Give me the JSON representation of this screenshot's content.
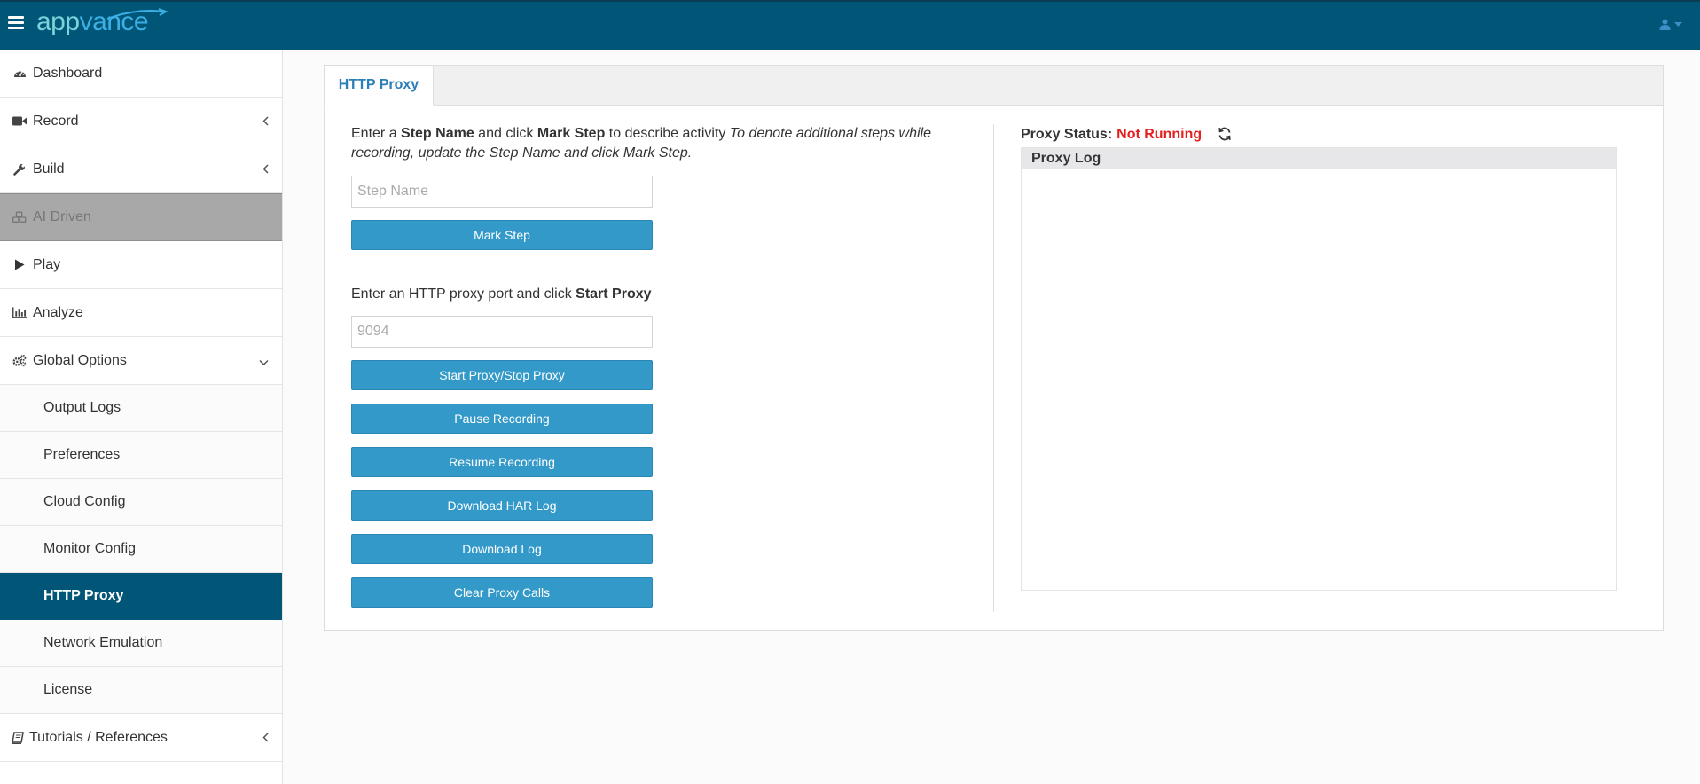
{
  "app": {
    "logo_part1": "app",
    "logo_part2": "vance"
  },
  "sidebar": {
    "items": [
      {
        "label": "Dashboard",
        "icon": "dashboard-icon"
      },
      {
        "label": "Record",
        "icon": "video-camera-icon"
      },
      {
        "label": "Build",
        "icon": "wrench-icon"
      },
      {
        "label": "AI Driven",
        "icon": "cubes-icon"
      },
      {
        "label": "Play",
        "icon": "play-icon"
      },
      {
        "label": "Analyze",
        "icon": "bar-chart-icon"
      },
      {
        "label": "Global Options",
        "icon": "gears-icon"
      }
    ],
    "sub_items": [
      "Output Logs",
      "Preferences",
      "Cloud Config",
      "Monitor Config",
      "HTTP Proxy",
      "Network Emulation",
      "License"
    ],
    "footer_item": {
      "label": "Tutorials / References",
      "icon": "book-icon"
    },
    "active_sub_item": "HTTP Proxy"
  },
  "main": {
    "tab_label": "HTTP Proxy",
    "step_instructions": {
      "t1": "Enter a ",
      "b1": "Step Name",
      "t2": " and click ",
      "b2": "Mark Step",
      "t3": " to describe activity ",
      "i1": "To denote additional steps while recording, update the Step Name and click Mark Step."
    },
    "step_name_placeholder": "Step Name",
    "mark_step_label": "Mark Step",
    "proxy_instructions": {
      "t1": "Enter an HTTP proxy port and click ",
      "b1": "Start Proxy"
    },
    "port_placeholder": "9094",
    "buttons": {
      "start_stop": "Start Proxy/Stop Proxy",
      "pause": "Pause Recording",
      "resume": "Resume Recording",
      "download_har": "Download HAR Log",
      "download_log": "Download Log",
      "clear_calls": "Clear Proxy Calls"
    },
    "proxy_status_label": "Proxy Status:",
    "proxy_status_value": "Not Running",
    "proxy_status_color": "#e52020",
    "proxy_log_title": "Proxy Log"
  },
  "colors": {
    "topbar": "#015677",
    "button": "#3399c8",
    "active_nav": "#015677",
    "tab_text": "#2a7fb6"
  }
}
